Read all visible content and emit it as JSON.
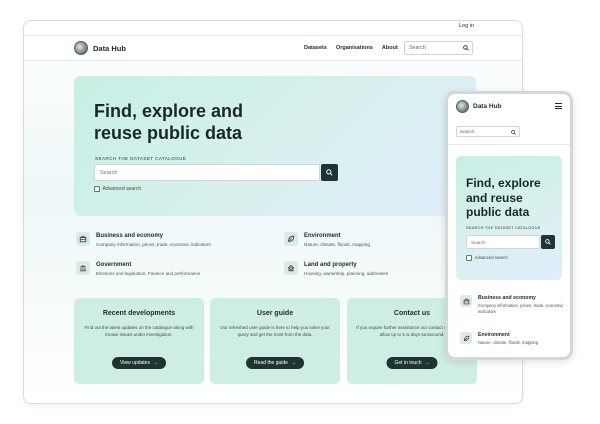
{
  "desktop": {
    "login": "Log in",
    "brand": "Data Hub",
    "nav": [
      "Datasets",
      "Organisations",
      "About"
    ],
    "nav_search_placeholder": "Search",
    "hero": {
      "title_line1": "Find, explore and",
      "title_line2": "reuse public data",
      "catalogue_label": "SEARCH THE DATASET CATALOGUE",
      "search_placeholder": "Search",
      "advanced_label": "Advanced search"
    },
    "topics": [
      {
        "title": "Business and economy",
        "desc": "Company information, prices, trade, economic indicators",
        "icon": "building-icon"
      },
      {
        "title": "Environment",
        "desc": "Nature, climate, floods, mapping",
        "icon": "leaf-icon"
      },
      {
        "title": "Government",
        "desc": "Elections and legislation, Finance and performance",
        "icon": "government-icon"
      },
      {
        "title": "Land and property",
        "desc": "Housing, ownership, planning, addresses",
        "icon": "house-icon"
      }
    ],
    "cards": [
      {
        "title": "Recent developments",
        "desc": "Find out the latest updates on the catalogue along with known issues under investigation.",
        "button": "View updates"
      },
      {
        "title": "User guide",
        "desc": "Our refreshed user guide is here to help you solve your query and get the most from the data.",
        "button": "Read the guide"
      },
      {
        "title": "Contact us",
        "desc": "If you require further assistance our contact support and allow up to 5 w days turnaround.",
        "button": "Get in touch"
      }
    ]
  },
  "mobile": {
    "brand": "Data Hub",
    "search_placeholder": "Search",
    "hero": {
      "title_line1": "Find, explore",
      "title_line2": "and reuse",
      "title_line3": "public data",
      "catalogue_label": "SEARCH THE DATASET CATALOGUE",
      "search_placeholder": "Search",
      "advanced_label": "Advanced search"
    },
    "topics": [
      {
        "title": "Business and economy",
        "desc": "Company information, prices, trade, economic indicators"
      },
      {
        "title": "Environment",
        "desc": "Nature, climate, floods, mapping"
      }
    ]
  },
  "colors": {
    "accent_dark": "#1d3432",
    "hero_mint": "#c7efe4",
    "card_mint": "#cfeee2"
  }
}
